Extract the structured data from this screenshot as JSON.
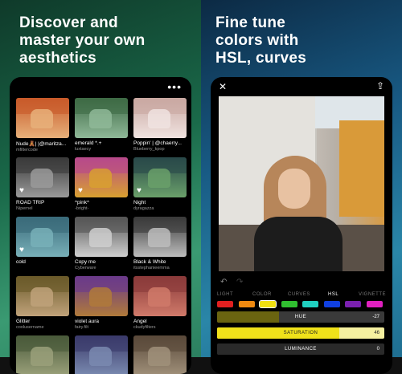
{
  "left": {
    "headline": "Discover and\nmaster your own\naesthetics",
    "more_icon": "more-horizontal-icon",
    "presets": [
      {
        "name": "Nude🧸| |@maritza...",
        "user": "mfiltercode",
        "thumb": [
          "#c85a2a",
          "#e7b07a"
        ],
        "heart": false
      },
      {
        "name": "emerald *.+",
        "user": "luxtaecy",
        "thumb": [
          "#3e6a45",
          "#8fb898"
        ],
        "heart": false
      },
      {
        "name": "Poppin' | @chaerry...",
        "user": "Blueberry_kpop",
        "thumb": [
          "#c9a8a2",
          "#f0e3e0"
        ],
        "heart": false
      },
      {
        "name": "ROAD TRIP",
        "user": "Nipernel",
        "thumb": [
          "#3a3a3a",
          "#9a9a9a"
        ],
        "heart": true
      },
      {
        "name": "^pink^",
        "user": "-bright-",
        "thumb": [
          "#b84a8a",
          "#d8a030"
        ],
        "heart": true
      },
      {
        "name": "Night",
        "user": "dyragazza",
        "thumb": [
          "#2a4a4a",
          "#6aa06a"
        ],
        "heart": true
      },
      {
        "name": "cold",
        "user": "",
        "thumb": [
          "#3a6a7a",
          "#78b0b8"
        ],
        "heart": true
      },
      {
        "name": "Copy me",
        "user": "Cyberware",
        "thumb": [
          "#555555",
          "#cfcfcf"
        ],
        "heart": false
      },
      {
        "name": "Black & White",
        "user": "itsstephanieemma",
        "thumb": [
          "#3a3a3a",
          "#bdbdbd"
        ],
        "heart": false
      },
      {
        "name": "Glitter",
        "user": "coolusername",
        "thumb": [
          "#6a5a2a",
          "#c0a27a"
        ],
        "heart": false
      },
      {
        "name": "violet aura",
        "user": "fairy.filt",
        "thumb": [
          "#6a3a8a",
          "#b07a3a"
        ],
        "heart": false
      },
      {
        "name": "Angel",
        "user": "ckudyfilters",
        "thumb": [
          "#8a3a3a",
          "#d07a6a"
        ],
        "heart": false
      },
      {
        "name": "",
        "user": "",
        "thumb": [
          "#4a5a3a",
          "#9aa07a"
        ],
        "heart": false
      },
      {
        "name": "",
        "user": "",
        "thumb": [
          "#3a3a6a",
          "#7a8ab0"
        ],
        "heart": false
      },
      {
        "name": "",
        "user": "",
        "thumb": [
          "#5a4a3a",
          "#a0907a"
        ],
        "heart": false
      }
    ]
  },
  "right": {
    "headline": "Fine tune\ncolors with\nHSL, curves",
    "close_icon": "close-icon",
    "share_icon": "share-icon",
    "undo_icon": "undo-icon",
    "redo_icon": "redo-icon",
    "tabs": [
      {
        "label": "LIGHT",
        "active": false
      },
      {
        "label": "COLOR",
        "active": false
      },
      {
        "label": "CURVES",
        "active": false
      },
      {
        "label": "HSL",
        "active": true
      },
      {
        "label": "VIGNETTE",
        "active": false
      }
    ],
    "swatches": [
      "#e02020",
      "#f08a10",
      "#f0e010",
      "#30c030",
      "#20d0c0",
      "#1040e0",
      "#7a20b0",
      "#e020c0"
    ],
    "selected_swatch": 2,
    "sliders": [
      {
        "label": "HUE",
        "value": "-27",
        "fill": 0.37,
        "fill_color": "#6a6410",
        "track_color": "#3a3a3a"
      },
      {
        "label": "SATURATION",
        "value": "46",
        "fill": 0.73,
        "fill_color": "#f0e21a",
        "track_color": "#f5f0a0"
      },
      {
        "label": "LUMINANCE",
        "value": "0",
        "fill": 0.5,
        "fill_color": "#2a2a2a",
        "track_color": "#2a2a2a"
      }
    ]
  }
}
